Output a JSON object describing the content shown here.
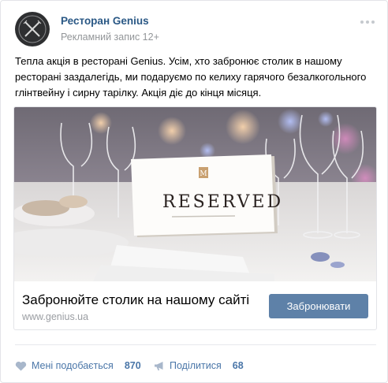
{
  "post": {
    "author": "Ресторан Genius",
    "subline": "Рекламний запис 12+",
    "body_text": "Тепла акція в ресторані Genius. Усім, хто забронює столик в нашому ресторані заздалегідь, ми подаруємо по келиху гарячого безалкогольного глінтвейну і сирну тарілку. Акція діє до кінця місяця.",
    "body_lines": [
      "Тепла акція в ресторані Genius. Усім, хто забронює столик в нашому",
      "ресторані заздалегідь, ми подаруємо по келиху гарячого безалкогольного",
      "глінтвейну і сирну тарілку. Акція діє до кінця місяця."
    ],
    "photo_sign_text": "RESERVED"
  },
  "link_card": {
    "title": "Забронюйте столик на нашому сайті",
    "domain": "www.genius.ua",
    "button_label": "Забронювати"
  },
  "actions": {
    "like_label": "Мені подобається",
    "like_count": "870",
    "share_label": "Поділитися",
    "share_count": "68"
  },
  "icons": {
    "avatar": "fork-knife-logo-icon",
    "more": "more-dots-icon",
    "like": "heart-icon",
    "share": "megaphone-icon"
  },
  "colors": {
    "link_blue": "#2a5885",
    "button_blue": "#5e81a8",
    "muted_gray": "#939699",
    "action_blue": "#4a76a8"
  }
}
